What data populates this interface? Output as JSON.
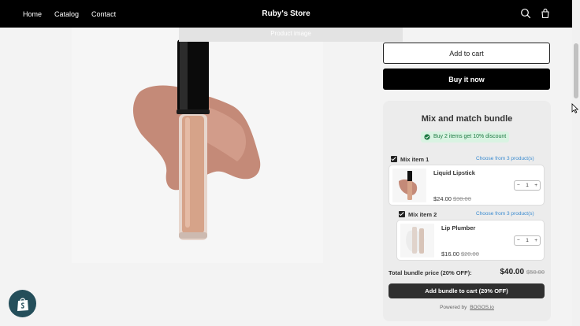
{
  "header": {
    "nav": [
      {
        "label": "Home"
      },
      {
        "label": "Catalog"
      },
      {
        "label": "Contact"
      }
    ],
    "brand": "Ruby's Store",
    "icons": [
      "search-icon",
      "cart-icon"
    ]
  },
  "media": {
    "banner_text": "Product image"
  },
  "product_actions": {
    "add_to_cart": "Add to cart",
    "buy_now": "Buy it now"
  },
  "bundle": {
    "title": "Mix and match bundle",
    "discount_badge": "Buy 2 items get 10% discount",
    "items": [
      {
        "label": "Mix item 1",
        "choose": "Choose from 3 product(s)",
        "name": "Liquid Lipstick",
        "price": "$24.00",
        "compare_price": "$30.00",
        "quantity": "1"
      },
      {
        "label": "Mix item 2",
        "choose": "Choose from 3 product(s)",
        "name": "Lip Plumber",
        "price": "$16.00",
        "compare_price": "$20.00",
        "quantity": "1"
      }
    ],
    "total_label": "Total bundle price (20% OFF):",
    "total_price": "$40.00",
    "total_compare": "$50.00",
    "add_button": "Add bundle to cart (20% OFF)",
    "powered_by": "Powered by",
    "powered_brand": "BOGOS.io"
  },
  "colors": {
    "accent_link": "#3a8bd0",
    "discount_bg": "#d9f3e2",
    "discount_text": "#1e7a43",
    "header_bg": "#000000"
  }
}
